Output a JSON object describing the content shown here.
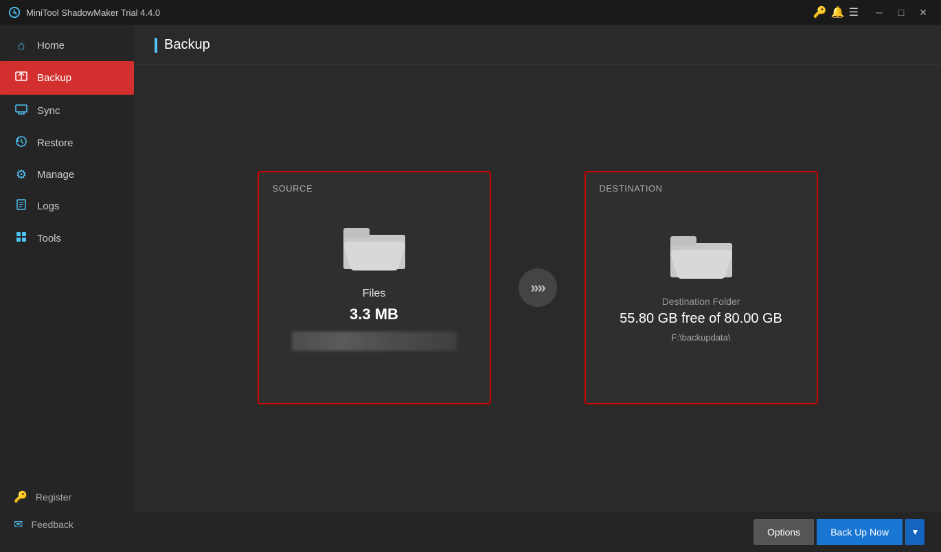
{
  "titlebar": {
    "title": "MiniTool ShadowMaker Trial 4.4.0",
    "icons": [
      "key-icon",
      "bell-icon",
      "menu-icon"
    ],
    "buttons": [
      "minimize",
      "maximize",
      "close"
    ]
  },
  "sidebar": {
    "items": [
      {
        "id": "home",
        "label": "Home",
        "icon": "home"
      },
      {
        "id": "backup",
        "label": "Backup",
        "icon": "backup",
        "active": true
      },
      {
        "id": "sync",
        "label": "Sync",
        "icon": "sync"
      },
      {
        "id": "restore",
        "label": "Restore",
        "icon": "restore"
      },
      {
        "id": "manage",
        "label": "Manage",
        "icon": "manage"
      },
      {
        "id": "logs",
        "label": "Logs",
        "icon": "logs"
      },
      {
        "id": "tools",
        "label": "Tools",
        "icon": "tools"
      }
    ],
    "bottom": [
      {
        "id": "register",
        "label": "Register",
        "icon": "key"
      },
      {
        "id": "feedback",
        "label": "Feedback",
        "icon": "mail"
      }
    ]
  },
  "page": {
    "title": "Backup"
  },
  "source": {
    "label": "SOURCE",
    "icon_type": "folder_open",
    "name": "Files",
    "size": "3.3 MB"
  },
  "destination": {
    "label": "DESTINATION",
    "icon_type": "folder_open",
    "name": "Destination Folder",
    "storage": "55.80 GB free of 80.00 GB",
    "path": "F:\\backupdata\\"
  },
  "arrow": ">>>",
  "buttons": {
    "options": "Options",
    "backup_now": "Back Up Now",
    "dropdown_arrow": "▼"
  }
}
